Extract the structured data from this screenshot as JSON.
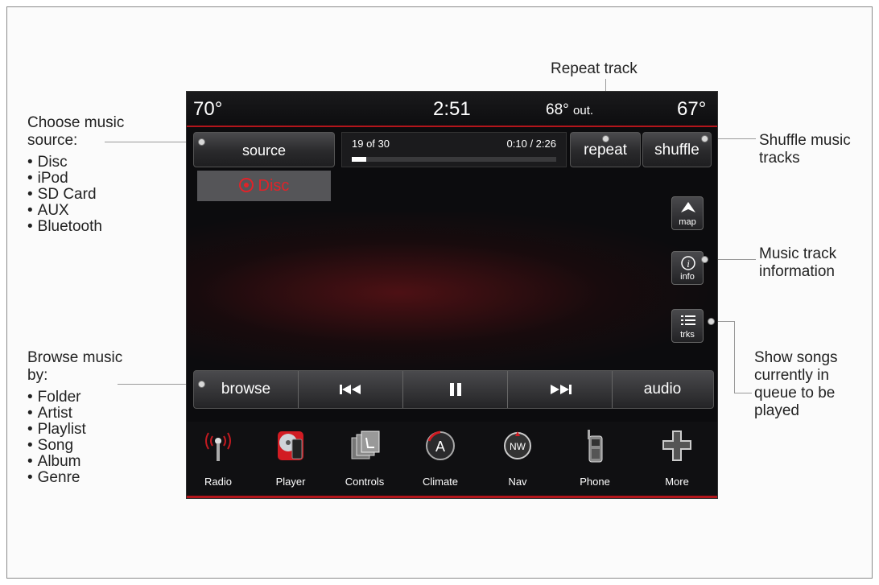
{
  "status": {
    "temp_left": "70°",
    "time": "2:51",
    "temp_out": "68°",
    "out_label": "out.",
    "temp_right": "67°"
  },
  "top_controls": {
    "source_label": "source",
    "selected_source": "Disc",
    "track_position": "19 of 30",
    "elapsed_total": "0:10 / 2:26",
    "progress_fraction": 0.07,
    "repeat_label": "repeat",
    "shuffle_label": "shuffle"
  },
  "side_buttons": [
    {
      "label": "map",
      "icon": "map-arrow-icon"
    },
    {
      "label": "info",
      "icon": "info-icon"
    },
    {
      "label": "trks",
      "icon": "list-icon"
    }
  ],
  "playback_bar": {
    "browse_label": "browse",
    "prev_icon": "previous-track-icon",
    "pause_icon": "pause-icon",
    "next_icon": "next-track-icon",
    "audio_label": "audio"
  },
  "dock": [
    {
      "label": "Radio",
      "icon": "radio-antenna-icon"
    },
    {
      "label": "Player",
      "icon": "player-disc-icon"
    },
    {
      "label": "Controls",
      "icon": "controls-seat-icon"
    },
    {
      "label": "Climate",
      "icon": "climate-icon"
    },
    {
      "label": "Nav",
      "icon": "compass-icon"
    },
    {
      "label": "Phone",
      "icon": "phone-icon"
    },
    {
      "label": "More",
      "icon": "plus-icon"
    }
  ],
  "annotations": {
    "choose_source_title": "Choose music source:",
    "sources": [
      "Disc",
      "iPod",
      "SD Card",
      "AUX",
      "Bluetooth"
    ],
    "browse_title": "Browse music by:",
    "browse_options": [
      "Folder",
      "Artist",
      "Playlist",
      "Song",
      "Album",
      "Genre"
    ],
    "repeat_track": "Repeat track",
    "shuffle_tracks": "Shuffle music tracks",
    "track_info": "Music track information",
    "queue": "Show songs currently in queue to be played"
  },
  "colors": {
    "accent_red": "#b3151b",
    "selected_source_red": "#e02329",
    "screen_bg": "#0c0c0e"
  }
}
